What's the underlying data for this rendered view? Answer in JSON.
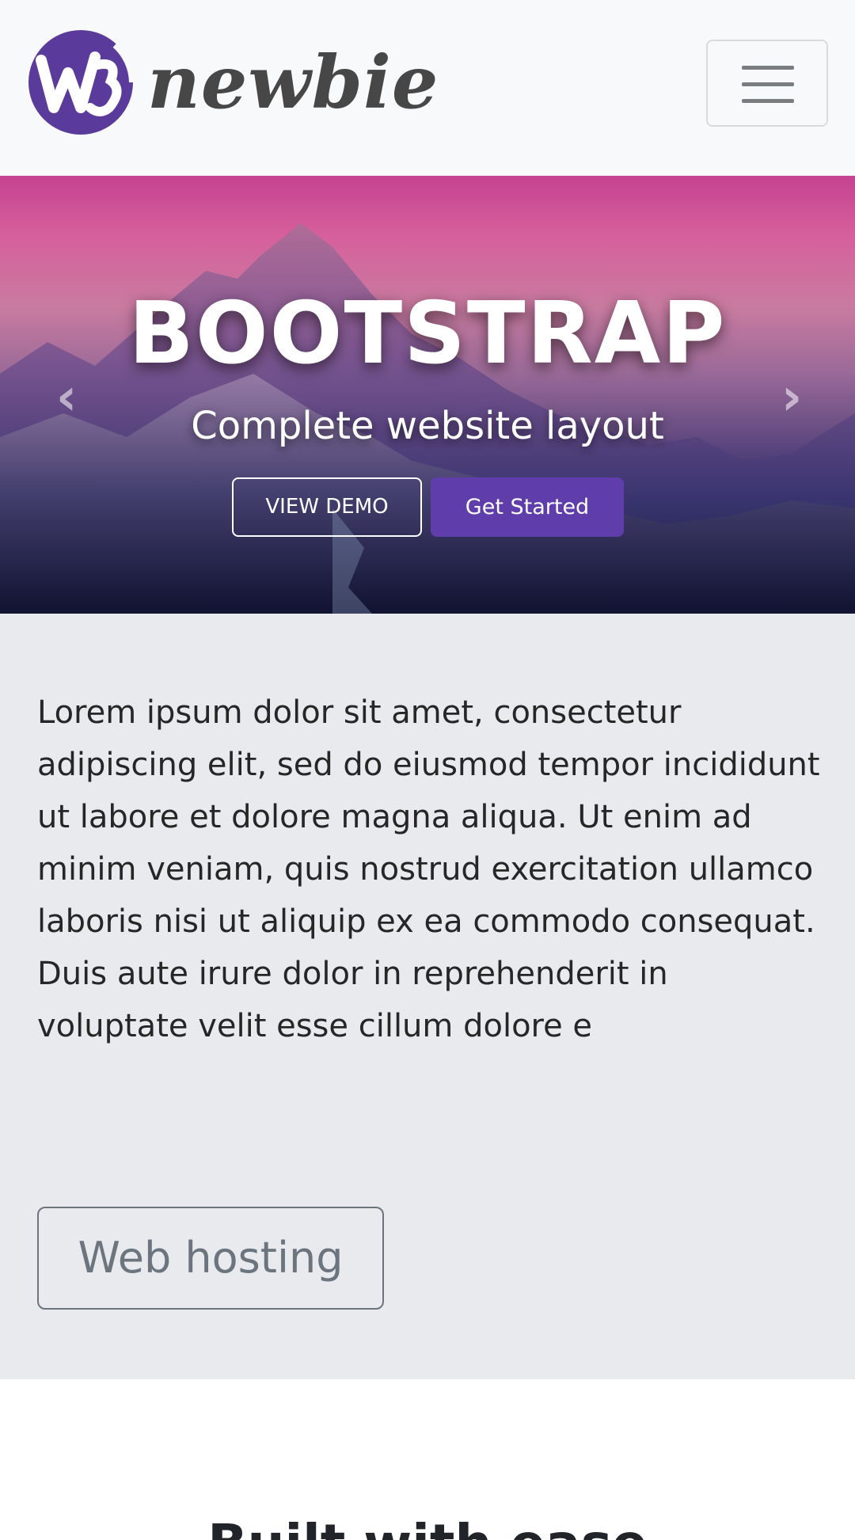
{
  "navbar": {
    "brand_mark": "W3",
    "brand_text": "newbie",
    "toggler_icon": "hamburger-icon",
    "colors": {
      "brand_mark": "#5a3a9a",
      "brand_text": "#474747"
    }
  },
  "hero": {
    "title": "BOOTSTRAP",
    "subtitle": "Complete website layout",
    "demo_button": "VIEW DEMO",
    "start_button": "Get Started",
    "prev_icon": "chevron-left-icon",
    "next_icon": "chevron-right-icon",
    "prev_glyph": "‹",
    "next_glyph": "›",
    "colors": {
      "primary": "#5f3eac"
    }
  },
  "intro": {
    "paragraph": "Lorem ipsum dolor sit amet, consectetur adipiscing elit, sed do eiusmod tempor incididunt ut labore et dolore magna aliqua. Ut enim ad minim veniam, quis nostrud exercitation ullamco laboris nisi ut aliquip ex ea commodo consequat. Duis aute irure dolor in reprehenderit in voluptate velit esse cillum dolore e",
    "hosting_button": "Web hosting"
  },
  "next_section": {
    "heading": "Built with ease"
  }
}
